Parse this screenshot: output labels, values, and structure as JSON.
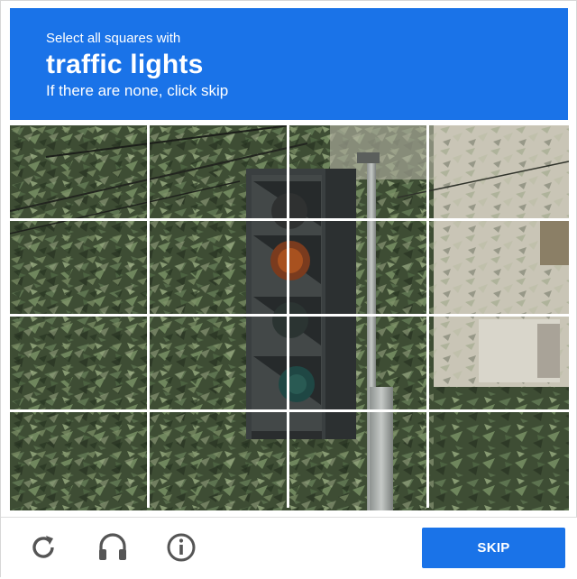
{
  "prompt": {
    "instruction": "Select all squares with",
    "target": "traffic lights",
    "hint": "If there are none, click skip"
  },
  "grid": {
    "rows": 4,
    "columns": 4
  },
  "footer": {
    "reload_icon": "reload-icon",
    "audio_icon": "headphones-icon",
    "info_icon": "info-icon",
    "skip_label": "SKIP"
  },
  "colors": {
    "accent": "#1a73e8",
    "icon": "#555555"
  }
}
